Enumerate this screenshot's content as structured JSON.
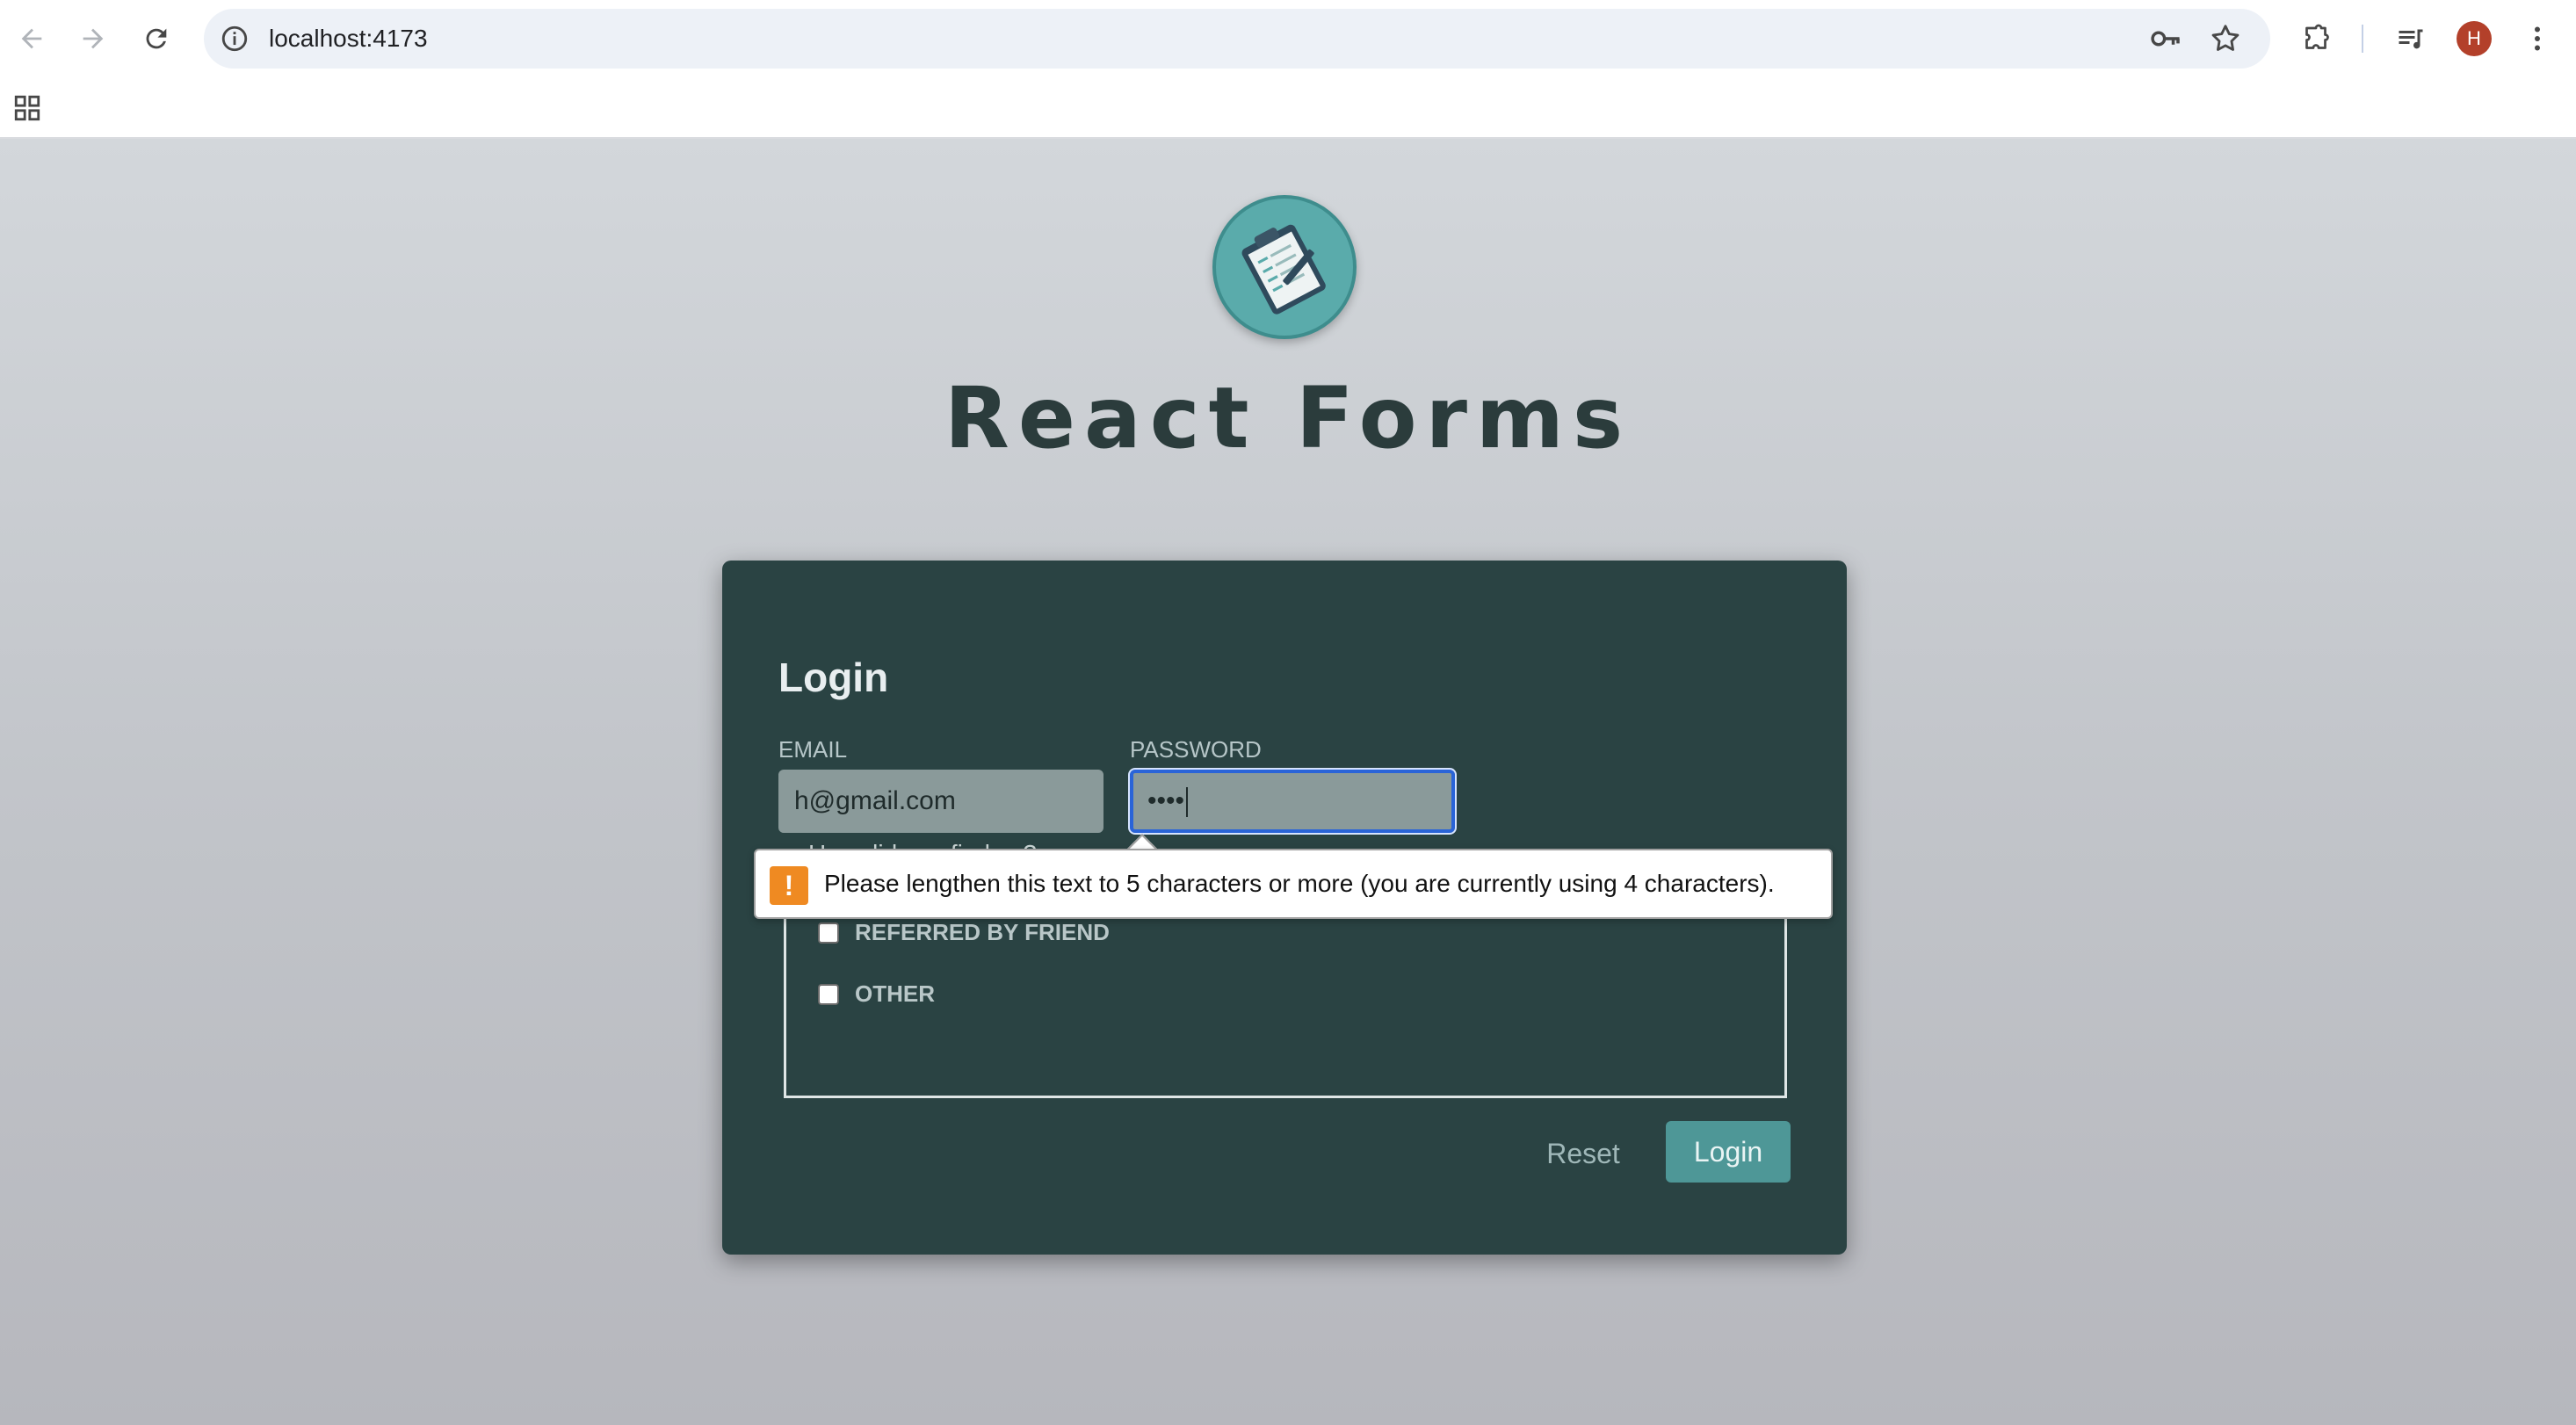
{
  "browser": {
    "url": "localhost:4173",
    "avatar_initial": "H"
  },
  "page": {
    "app_title": "React Forms",
    "logo_icon": "clipboard-form-icon"
  },
  "form": {
    "title": "Login",
    "email_label": "EMAIL",
    "email_value": "h@gmail.com",
    "password_label": "PASSWORD",
    "password_value": "••••",
    "partially_hidden_label": "How did you find us?",
    "options": [
      {
        "label": "REFERRED BY FRIEND",
        "checked": false
      },
      {
        "label": "OTHER",
        "checked": false
      }
    ],
    "reset_label": "Reset",
    "submit_label": "Login"
  },
  "validation_tooltip": {
    "message": "Please lengthen this text to 5 characters or more (you are currently using 4 characters).",
    "icon": "warning-icon"
  },
  "colors": {
    "card_bg": "#2a4343",
    "accent": "#4e9797",
    "focus_ring": "#2a64d8",
    "warning": "#ef8a22"
  }
}
